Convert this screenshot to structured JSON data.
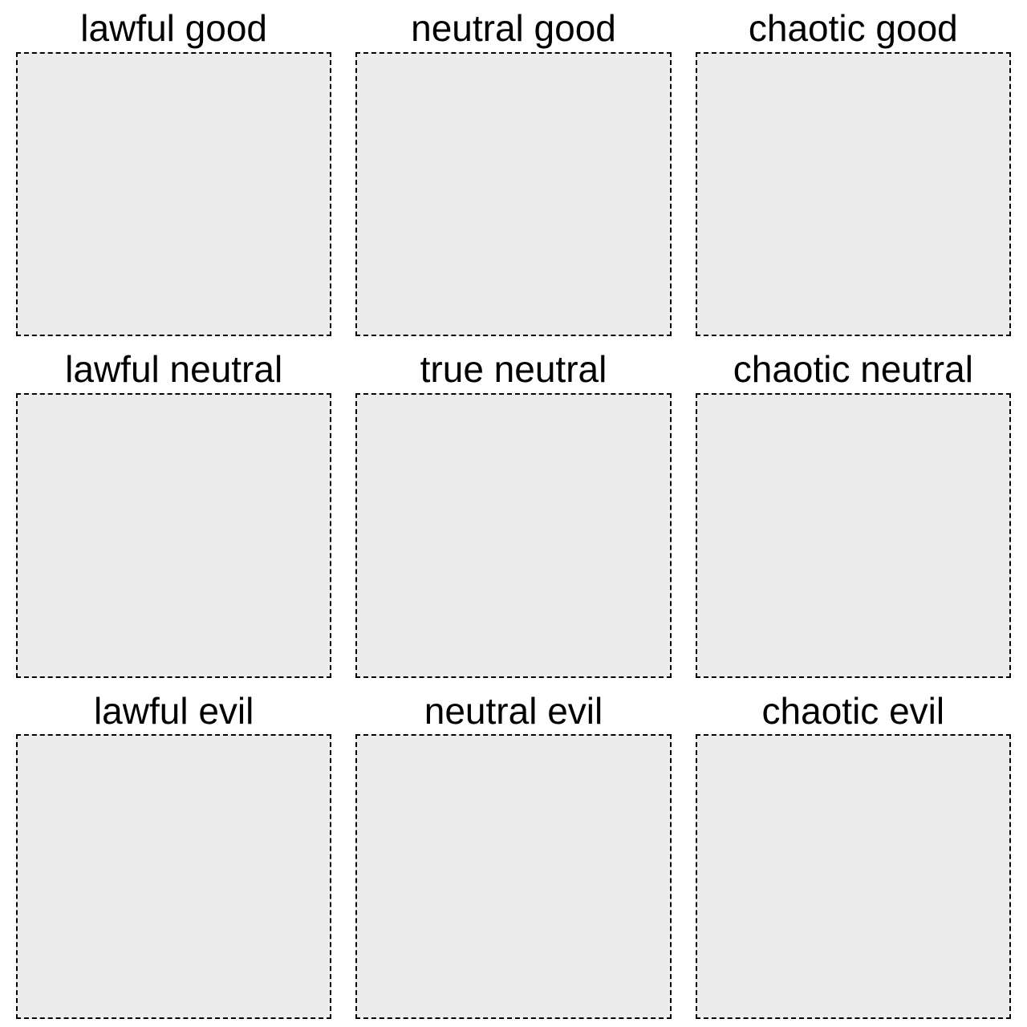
{
  "cells": [
    {
      "label": "lawful good"
    },
    {
      "label": "neutral good"
    },
    {
      "label": "chaotic good"
    },
    {
      "label": "lawful neutral"
    },
    {
      "label": "true neutral"
    },
    {
      "label": "chaotic neutral"
    },
    {
      "label": "lawful evil"
    },
    {
      "label": "neutral evil"
    },
    {
      "label": "chaotic evil"
    }
  ]
}
